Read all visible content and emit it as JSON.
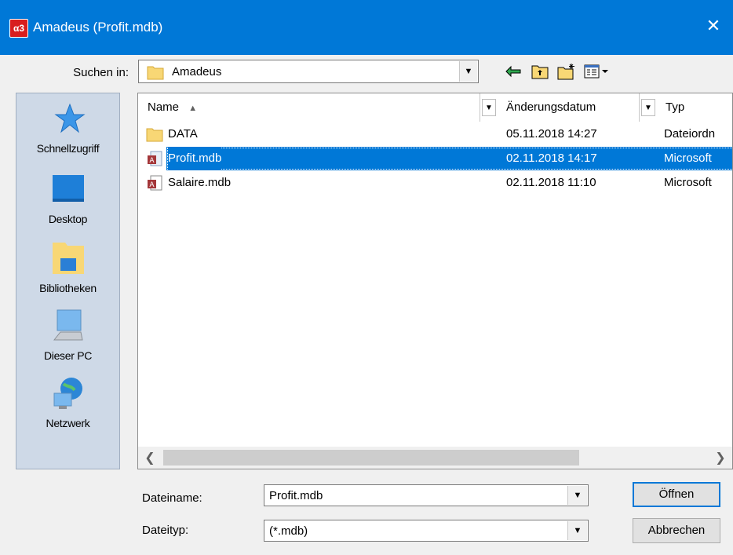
{
  "window": {
    "title": "Amadeus (Profit.mdb)",
    "app_icon_text": "α3",
    "close_glyph": "✕"
  },
  "lookin": {
    "label": "Suchen in:",
    "value": "Amadeus"
  },
  "places": [
    {
      "label": "Schnellzugriff",
      "icon": "star-icon"
    },
    {
      "label": "Desktop",
      "icon": "desktop-icon"
    },
    {
      "label": "Bibliotheken",
      "icon": "library-icon"
    },
    {
      "label": "Dieser PC",
      "icon": "computer-icon"
    },
    {
      "label": "Netzwerk",
      "icon": "network-icon"
    }
  ],
  "columns": {
    "name": "Name",
    "date": "Änderungsdatum",
    "type": "Typ",
    "sort_glyph": "▲"
  },
  "files": [
    {
      "name": "DATA",
      "date": "05.11.2018 14:27",
      "type": "Dateiordn",
      "icon": "folder-icon"
    },
    {
      "name": "Profit.mdb",
      "date": "02.11.2018 14:17",
      "type": "Microsoft",
      "icon": "access-db-icon",
      "selected": true
    },
    {
      "name": "Salaire.mdb",
      "date": "02.11.2018 11:10",
      "type": "Microsoft",
      "icon": "access-db-icon"
    }
  ],
  "filename": {
    "label": "Dateiname:",
    "value": "Profit.mdb"
  },
  "filetype": {
    "label": "Dateityp:",
    "value": "(*.mdb)"
  },
  "buttons": {
    "open": "Öffnen",
    "cancel": "Abbrechen"
  },
  "colors": {
    "titlebar": "#0078d7",
    "selection": "#0078d7",
    "places_bg": "#ced9e7"
  }
}
